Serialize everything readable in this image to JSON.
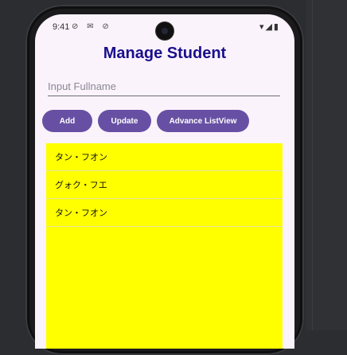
{
  "status_bar": {
    "time": "9:41",
    "left_icons": "⊘ ✉ ⊘",
    "right_icons": "▾◢▮"
  },
  "app": {
    "title": "Manage Student"
  },
  "form": {
    "fullname_placeholder": "Input Fullname",
    "fullname_value": ""
  },
  "buttons": {
    "add": "Add",
    "update": "Update",
    "advance": "Advance ListView"
  },
  "students": [
    {
      "name": "タン・フオン"
    },
    {
      "name": "グォク・フエ"
    },
    {
      "name": "タン・フオン"
    }
  ],
  "colors": {
    "title": "#1a0f8c",
    "button": "#6750a4",
    "list_background": "#ffff00",
    "screen_background": "#fbf3fc"
  }
}
